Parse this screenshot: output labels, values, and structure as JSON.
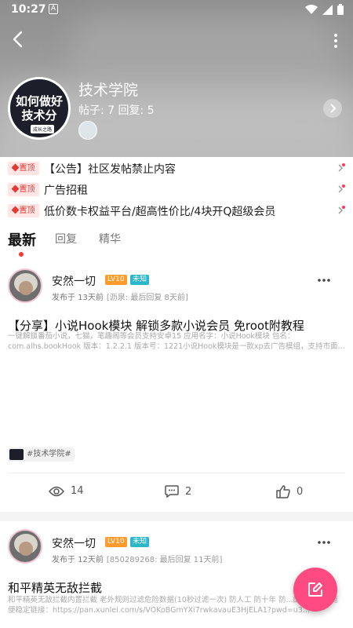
{
  "status": {
    "time": "10:27",
    "notif_glyph": "A"
  },
  "forum": {
    "name": "技术学院",
    "stats": "帖子: 7 回复: 5",
    "logo_line1": "如何做好",
    "logo_line2": "技术分",
    "logo_line3": "成长之路"
  },
  "pinned": [
    {
      "badge": "置顶",
      "text": "【公告】社区发帖禁止内容"
    },
    {
      "badge": "置顶",
      "text": "广告招租"
    },
    {
      "badge": "置顶",
      "text": "低价数卡权益平台/超高性价比/4块开Q超级会员"
    }
  ],
  "tabs": [
    "最新",
    "回复",
    "精华"
  ],
  "posts": [
    {
      "author": "安然一切",
      "level": "LV10",
      "badge": "未知",
      "meta": "发布于 13天前",
      "meta_sub": "[沥泉: 最后回复 8天前]",
      "title": "【分享】小说Hook模块 解锁多款小说会员 免root附教程",
      "excerpt": "一键解锁番茄小说，七猫，笔趣阁等会员支持安卓15 应用名字：小说Hook模块 包名：com.alhs.bookHook 版本：1.2.2.1 版本号：1221小说Hook模块是一款xp去广告模组，支持市面...",
      "tag": "#技术学院#",
      "views": "14",
      "comments": "2",
      "likes": "0"
    },
    {
      "author": "安然一切",
      "level": "LV10",
      "badge": "未知",
      "meta": "发布于 12天前",
      "meta_sub": "[850289268: 最后回复 11天前]",
      "title": "和平精英无敌拦截",
      "excerpt": "和平精英无敌拦截内置拦截 老外规则过滤危险数据(10秒过滤一次) 防人工 防十年 防...配一个直装随便稳定链接：https://pan.xunlei.com/s/VOKoBGmYXi7rwkavauE3HjELA1?pwd=u3..."
    }
  ],
  "icons": {
    "back": "back-arrow-icon",
    "more": "more-vertical-icon",
    "eye": "eye-icon",
    "comment": "comment-icon",
    "like": "thumbs-up-icon",
    "edit": "edit-icon"
  },
  "colors": {
    "accent": "#ff4a82",
    "pin_red": "#e53935",
    "level": "#ff9b2b",
    "badge_teal": "#2ab7c9"
  }
}
